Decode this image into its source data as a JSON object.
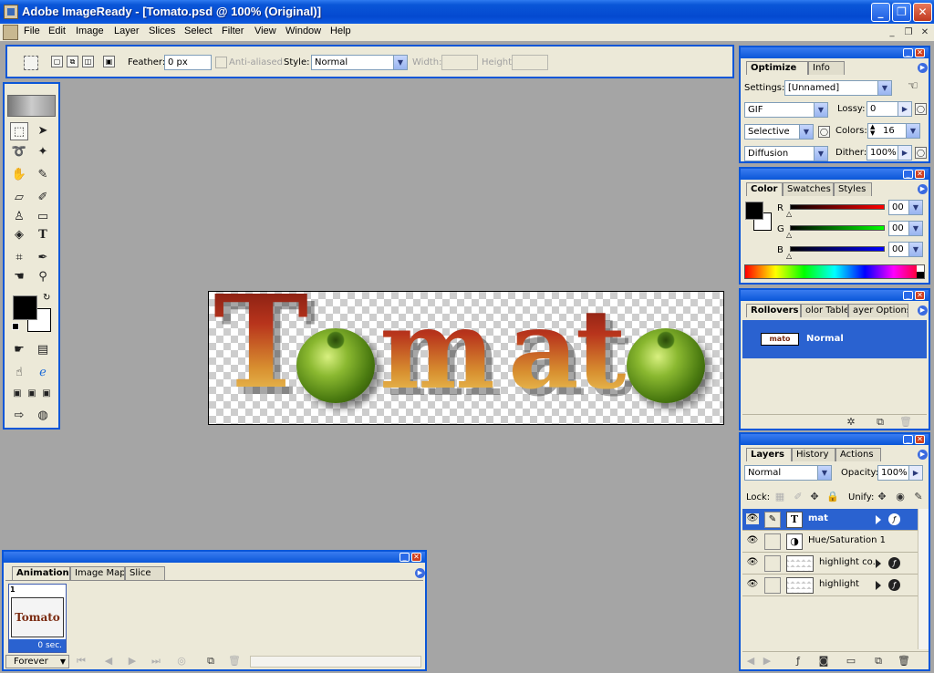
{
  "window": {
    "title": "Adobe ImageReady - [Tomato.psd @ 100% (Original)]",
    "buttons": {
      "minimize": "_",
      "maximize": "❐",
      "close": "✕"
    }
  },
  "menu": [
    "File",
    "Edit",
    "Image",
    "Layer",
    "Slices",
    "Select",
    "Filter",
    "View",
    "Window",
    "Help"
  ],
  "options_bar": {
    "feather_label": "Feather:",
    "feather_value": "0 px",
    "antialiased_label": "Anti-aliased",
    "style_label": "Style:",
    "style_value": "Normal",
    "width_label": "Width:",
    "height_label": "Height:"
  },
  "canvas": {
    "letters": [
      "T",
      "m",
      "a",
      "t"
    ]
  },
  "animation_panel": {
    "tabs": [
      "Animation",
      "Image Map",
      "Slice"
    ],
    "frame_number": "1",
    "frame_thumb_text": "Tomato",
    "frame_delay": "0 sec.",
    "loop": "Forever"
  },
  "optimize_panel": {
    "tabs": [
      "Optimize",
      "Info"
    ],
    "settings_label": "Settings:",
    "settings_value": "[Unnamed]",
    "format": "GIF",
    "lossy_label": "Lossy:",
    "lossy_value": "0",
    "palette": "Selective",
    "colors_label": "Colors:",
    "colors_value": "16",
    "dither_method": "Diffusion",
    "dither_label": "Dither:",
    "dither_value": "100%"
  },
  "color_panel": {
    "tabs": [
      "Color",
      "Swatches",
      "Styles"
    ],
    "r_label": "R",
    "r_value": "00",
    "g_label": "G",
    "g_value": "00",
    "b_label": "B",
    "b_value": "00"
  },
  "rollovers_panel": {
    "tabs": [
      "Rollovers",
      "olor Table",
      "ayer Options"
    ],
    "state_name": "Normal",
    "thumb_text": "mato"
  },
  "layers_panel": {
    "tabs": [
      "Layers",
      "History",
      "Actions"
    ],
    "blend_mode": "Normal",
    "opacity_label": "Opacity:",
    "opacity_value": "100%",
    "lock_label": "Lock:",
    "unify_label": "Unify:",
    "layers": [
      {
        "name": "mat",
        "thumb": "T",
        "selected": true
      },
      {
        "name": "Hue/Saturation 1",
        "thumb": "◑",
        "selected": false
      },
      {
        "name": "highlight co...",
        "thumb": "",
        "selected": false
      },
      {
        "name": "highlight",
        "thumb": "",
        "selected": false
      }
    ]
  },
  "colors": {
    "titlebar": "#0a56d8",
    "panel_bg": "#ece9d8",
    "workspace": "#a5a5a5",
    "selection": "#2a62d0"
  }
}
